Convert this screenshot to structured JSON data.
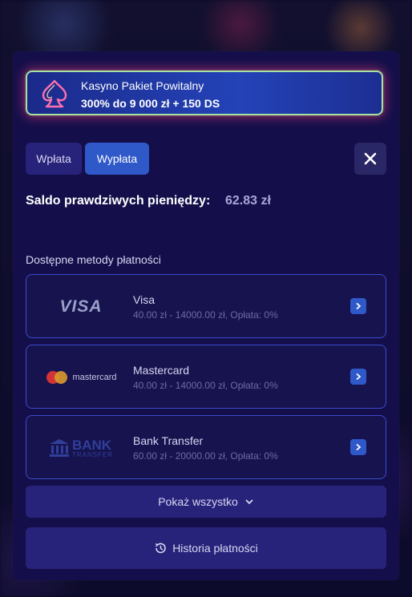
{
  "promo": {
    "title": "Kasyno Pakiet Powitalny",
    "subtitle": "300% do 9 000 zł + 150 DS",
    "icon": "spade-icon"
  },
  "tabs": [
    {
      "label": "Wpłata",
      "active": false
    },
    {
      "label": "Wypłata",
      "active": true
    }
  ],
  "balance": {
    "label": "Saldo prawdziwych pieniędzy:",
    "value": "62.83 zł"
  },
  "methods_heading": "Dostępne metody płatności",
  "methods": [
    {
      "name": "Visa",
      "detail": "40.00 zł - 14000.00 zł, Opłata: 0%",
      "logo": "VISA"
    },
    {
      "name": "Mastercard",
      "detail": "40.00 zł - 14000.00 zł, Opłata: 0%",
      "logo": "mastercard"
    },
    {
      "name": "Bank Transfer",
      "detail": "60.00 zł - 20000.00 zł, Opłata: 0%",
      "logo": "BANK",
      "logo_sub": "TRANSFER"
    }
  ],
  "show_all_label": "Pokaż wszystko",
  "history_label": "Historia płatności",
  "colors": {
    "accent": "#2f58c9",
    "panel": "#140f4a",
    "promo_border": "#a6e3a0"
  }
}
